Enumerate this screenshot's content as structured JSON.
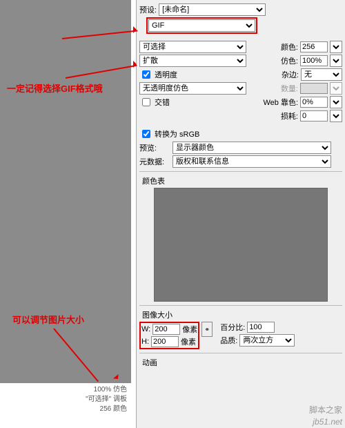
{
  "preset": {
    "label": "预设:",
    "value": "[未命名]"
  },
  "format": {
    "value": "GIF"
  },
  "reduction": {
    "value": "可选择"
  },
  "dither": {
    "value": "扩散"
  },
  "colors": {
    "label": "颜色:",
    "value": "256"
  },
  "ditherAmt": {
    "label": "仿色:",
    "value": "100%"
  },
  "matte": {
    "label": "杂边:",
    "value": "无"
  },
  "amount": {
    "label": "数量:",
    "value": ""
  },
  "transparency": {
    "label": "透明度"
  },
  "transDither": {
    "value": "无透明度仿色"
  },
  "interlaced": {
    "label": "交错"
  },
  "webSnap": {
    "label": "Web 靠色:",
    "value": "0%"
  },
  "lossy": {
    "label": "损耗:",
    "value": "0"
  },
  "srgb": {
    "label": "转换为 sRGB"
  },
  "previewRow": {
    "label": "预览:",
    "value": "显示器颜色"
  },
  "metadata": {
    "label": "元数据:",
    "value": "版权和联系信息"
  },
  "colorTable": {
    "title": "颜色表"
  },
  "imageSize": {
    "title": "图像大小",
    "w": "200",
    "h": "200",
    "unitW": "像素",
    "unitH": "像素",
    "wLabel": "W:",
    "hLabel": "H:"
  },
  "percent": {
    "label": "百分比:",
    "value": "100"
  },
  "quality": {
    "label": "品质:",
    "value": "两次立方"
  },
  "animation": {
    "title": "动画"
  },
  "note1": "一定记得选择GIF格式哦",
  "note2": "可以调节图片大小",
  "bottom": {
    "l1": "100% 仿色",
    "l2": "\"可选择\" 调板",
    "l3": "256 颜色"
  },
  "wm1": "jb51.net",
  "wm2": "脚本之家"
}
